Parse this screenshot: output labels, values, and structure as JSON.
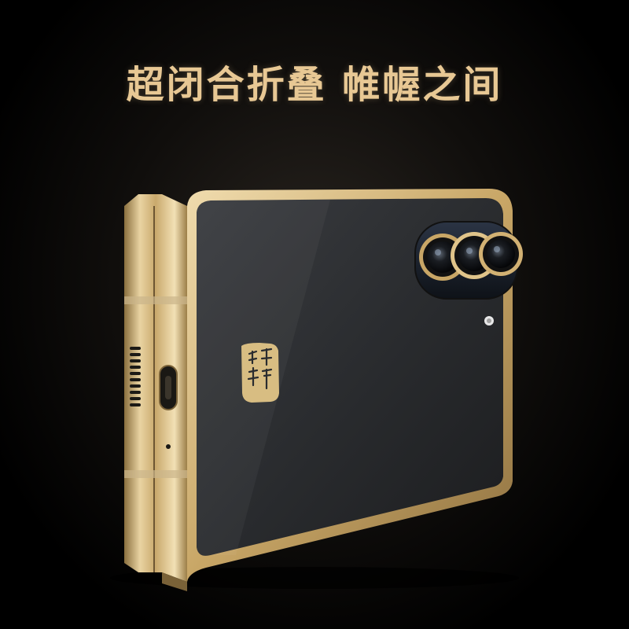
{
  "headline": "超闭合折叠 帷幄之间",
  "seal_text": "非凡大师",
  "colors": {
    "gold": "#e2c48a",
    "gold_dark": "#a8874f",
    "back_panel": "#2a2c2f",
    "text_gold": "#e8c894"
  },
  "depicted_objects": [
    "foldable-phone",
    "triple-camera-module",
    "seal-logo",
    "speaker-grille",
    "usb-c-port",
    "microphone-hole",
    "hinge"
  ]
}
